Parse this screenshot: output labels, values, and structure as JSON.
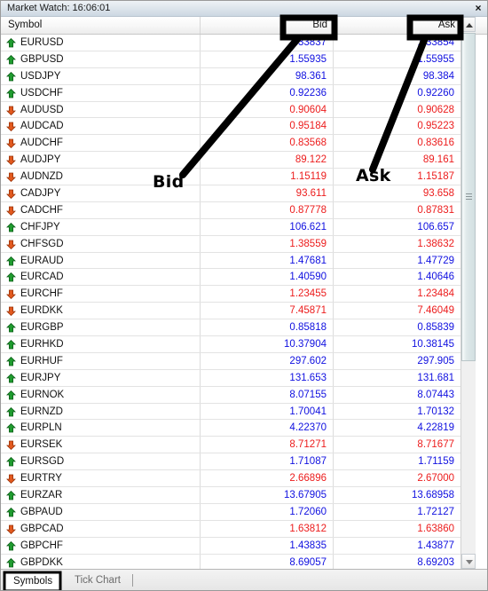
{
  "window": {
    "title": "Market Watch: 16:06:01",
    "close_label": "×",
    "close_icon": "close-icon"
  },
  "columns": {
    "symbol": "Symbol",
    "bid": "Bid",
    "ask": "Ask"
  },
  "colors": {
    "up_text": "#1010e0",
    "down_text": "#ec1c1c",
    "up_arrow": "#1f9c2f",
    "down_arrow": "#e2591e",
    "annotation": "#000000"
  },
  "annotations": [
    {
      "label": "Bid",
      "target": "bid-column-header"
    },
    {
      "label": "Ask",
      "target": "ask-column-header"
    }
  ],
  "rows": [
    {
      "symbol": "EURUSD",
      "dir": "up",
      "bid": "1.33837",
      "ask": "1.33854"
    },
    {
      "symbol": "GBPUSD",
      "dir": "up",
      "bid": "1.55935",
      "ask": "1.55955"
    },
    {
      "symbol": "USDJPY",
      "dir": "up",
      "bid": "98.361",
      "ask": "98.384"
    },
    {
      "symbol": "USDCHF",
      "dir": "up",
      "bid": "0.92236",
      "ask": "0.92260"
    },
    {
      "symbol": "AUDUSD",
      "dir": "down",
      "bid": "0.90604",
      "ask": "0.90628"
    },
    {
      "symbol": "AUDCAD",
      "dir": "down",
      "bid": "0.95184",
      "ask": "0.95223"
    },
    {
      "symbol": "AUDCHF",
      "dir": "down",
      "bid": "0.83568",
      "ask": "0.83616"
    },
    {
      "symbol": "AUDJPY",
      "dir": "down",
      "bid": "89.122",
      "ask": "89.161"
    },
    {
      "symbol": "AUDNZD",
      "dir": "down",
      "bid": "1.15119",
      "ask": "1.15187"
    },
    {
      "symbol": "CADJPY",
      "dir": "down",
      "bid": "93.611",
      "ask": "93.658"
    },
    {
      "symbol": "CADCHF",
      "dir": "down",
      "bid": "0.87778",
      "ask": "0.87831"
    },
    {
      "symbol": "CHFJPY",
      "dir": "up",
      "bid": "106.621",
      "ask": "106.657"
    },
    {
      "symbol": "CHFSGD",
      "dir": "down",
      "bid": "1.38559",
      "ask": "1.38632"
    },
    {
      "symbol": "EURAUD",
      "dir": "up",
      "bid": "1.47681",
      "ask": "1.47729"
    },
    {
      "symbol": "EURCAD",
      "dir": "up",
      "bid": "1.40590",
      "ask": "1.40646"
    },
    {
      "symbol": "EURCHF",
      "dir": "down",
      "bid": "1.23455",
      "ask": "1.23484"
    },
    {
      "symbol": "EURDKK",
      "dir": "down",
      "bid": "7.45871",
      "ask": "7.46049"
    },
    {
      "symbol": "EURGBP",
      "dir": "up",
      "bid": "0.85818",
      "ask": "0.85839"
    },
    {
      "symbol": "EURHKD",
      "dir": "up",
      "bid": "10.37904",
      "ask": "10.38145"
    },
    {
      "symbol": "EURHUF",
      "dir": "up",
      "bid": "297.602",
      "ask": "297.905"
    },
    {
      "symbol": "EURJPY",
      "dir": "up",
      "bid": "131.653",
      "ask": "131.681"
    },
    {
      "symbol": "EURNOK",
      "dir": "up",
      "bid": "8.07155",
      "ask": "8.07443"
    },
    {
      "symbol": "EURNZD",
      "dir": "up",
      "bid": "1.70041",
      "ask": "1.70132"
    },
    {
      "symbol": "EURPLN",
      "dir": "up",
      "bid": "4.22370",
      "ask": "4.22819"
    },
    {
      "symbol": "EURSEK",
      "dir": "down",
      "bid": "8.71271",
      "ask": "8.71677"
    },
    {
      "symbol": "EURSGD",
      "dir": "up",
      "bid": "1.71087",
      "ask": "1.71159"
    },
    {
      "symbol": "EURTRY",
      "dir": "down",
      "bid": "2.66896",
      "ask": "2.67000"
    },
    {
      "symbol": "EURZAR",
      "dir": "up",
      "bid": "13.67905",
      "ask": "13.68958"
    },
    {
      "symbol": "GBPAUD",
      "dir": "up",
      "bid": "1.72060",
      "ask": "1.72127"
    },
    {
      "symbol": "GBPCAD",
      "dir": "down",
      "bid": "1.63812",
      "ask": "1.63860"
    },
    {
      "symbol": "GBPCHF",
      "dir": "up",
      "bid": "1.43835",
      "ask": "1.43877"
    },
    {
      "symbol": "GBPDKK",
      "dir": "up",
      "bid": "8.69057",
      "ask": "8.69203"
    }
  ],
  "tabs": [
    {
      "label": "Symbols",
      "active": true
    },
    {
      "label": "Tick Chart",
      "active": false
    }
  ],
  "scrollbar": {
    "up_icon": "scroll-up-arrow-icon",
    "down_icon": "scroll-down-arrow-icon"
  }
}
